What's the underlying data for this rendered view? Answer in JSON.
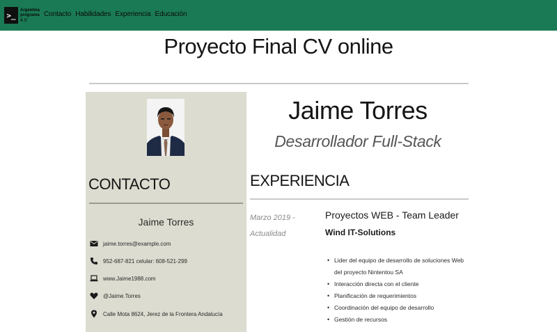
{
  "nav": {
    "brand_lines": [
      "Argentina",
      "programa",
      "4.0"
    ],
    "brand_glyph": ">_",
    "links": [
      "Contacto",
      "Habilidades",
      "Experiencia",
      "Educación"
    ]
  },
  "page": {
    "title": "Proyecto Final CV online"
  },
  "sidebar": {
    "heading": "CONTACTO",
    "name": "Jaime Torres",
    "items": [
      {
        "icon": "envelope-icon",
        "text": "jaime.torres@example.com"
      },
      {
        "icon": "phone-icon",
        "text": "952-687-821 celular: 608-521-299"
      },
      {
        "icon": "laptop-icon",
        "text": "www.Jaime1988.com"
      },
      {
        "icon": "heart-icon",
        "text": "@Jaime.Torres"
      },
      {
        "icon": "map-pin-icon",
        "text": "Calle Mota 8624, Jerez de la Frontera Andalucía"
      }
    ]
  },
  "main": {
    "name": "Jaime Torres",
    "role": "Desarrollador Full-Stack",
    "experience": {
      "heading": "EXPERIENCIA",
      "entries": [
        {
          "date_start": "Marzo 2019 -",
          "date_end": "Actualidad",
          "title": "Proyectos WEB - Team Leader",
          "company": "Wind IT-Solutions",
          "bullets": [
            "Lider del equipo de desarrollo de soluciones Web del proyecto Nintentou SA",
            "Interacción directa con el cliente",
            "Planificación de requerimientos",
            "Coordinación del equipo de desarrollo",
            "Gestión de recursos"
          ]
        }
      ]
    }
  },
  "colors": {
    "navbar": "#1a7a55",
    "sidebar_bg": "#dcdcd0",
    "rule": "#c9c9c9"
  }
}
